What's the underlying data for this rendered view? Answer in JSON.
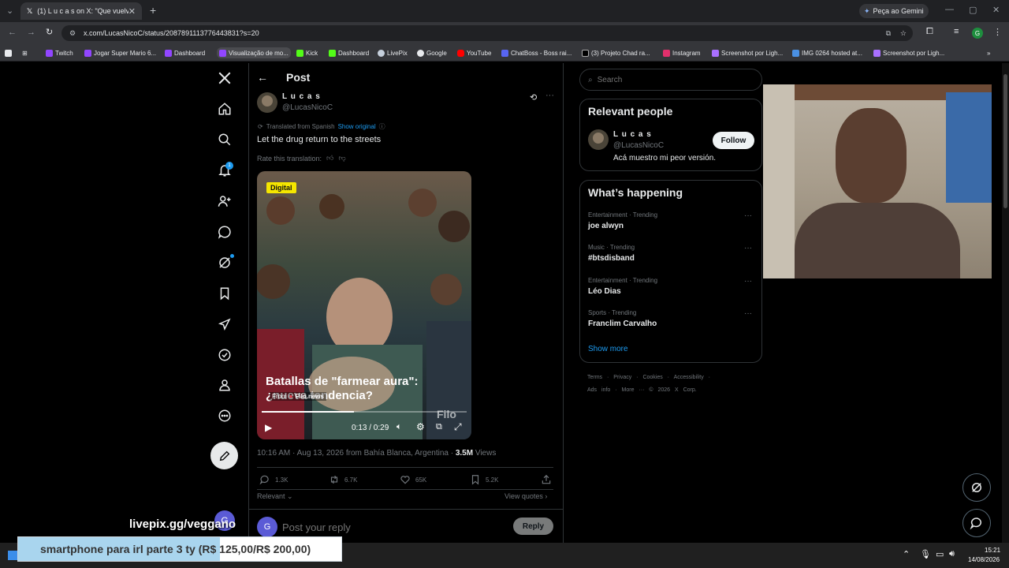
{
  "browser": {
    "active_tab_title": "(1) L u c a s on X: \"Que vuelva l...",
    "gemini_button": "Peça ao Gemini",
    "url": "x.com/LucasNicoC/status/2087891113776443831?s=20",
    "profile_initial": "G",
    "bookmarks": [
      "Twitch",
      "Jogar Super Mario 6...",
      "Dashboard",
      "Visualização de mo...",
      "Kick",
      "Dashboard",
      "LivePix",
      "Google",
      "YouTube",
      "ChatBoss - Boss rai...",
      "(3) Projeto Chad ra...",
      "Instagram",
      "Screenshot por Ligh...",
      "IMG 0264 hosted at...",
      "Screenshot por Ligh..."
    ]
  },
  "nav": {
    "notification_count": "1",
    "account_initial": "G"
  },
  "post": {
    "header_title": "Post",
    "author_name": "L u c a s",
    "author_handle": "@LucasNicoC",
    "translated_label": "Translated from Spanish",
    "show_original": "Show original",
    "text": "Let the drug return to the streets",
    "rate_translation": "Rate this translation:",
    "video": {
      "badge": "Digital",
      "caption_line1": "Batallas de \"farmear aura\":",
      "caption_line2": "¿nueva tendencia?",
      "from_label": "From",
      "source": "Filo.news",
      "watermark": "Filo",
      "time": "0:13 / 0:29",
      "progress": 0.45
    },
    "timestamp": "10:16 AM · Aug 13, 2026 from Bahía Blanca, Argentina · ",
    "views_count": "3.5M",
    "views_label": " Views",
    "replies": "1.3K",
    "reposts": "6.7K",
    "likes": "65K",
    "bookmarks": "5.2K",
    "relevant_label": "Relevant",
    "view_quotes": "View quotes",
    "reply_placeholder": "Post your reply",
    "reply_button": "Reply"
  },
  "sidebar": {
    "search_placeholder": "Search",
    "relevant_people_title": "Relevant people",
    "person_name": "L u c a s",
    "person_handle": "@LucasNicoC",
    "person_bio": "Acá muestro mi peor versión.",
    "follow_label": "Follow",
    "whats_happening_title": "What’s happening",
    "trends": [
      {
        "category": "Entertainment · Trending",
        "name": "joe alwyn"
      },
      {
        "category": "Music · Trending",
        "name": "#btsdisband"
      },
      {
        "category": "Entertainment · Trending",
        "name": "Léo Dias"
      },
      {
        "category": "Sports · Trending",
        "name": "Franclim Carvalho"
      }
    ],
    "show_more": "Show more",
    "footer_line1": "Terms · Privacy · Cookies · Accessibility ·",
    "footer_line2": "Ads info · More ··· © 2026 X Corp."
  },
  "overlay": {
    "livepix_text": "livepix.gg/veggano",
    "goal_text": "smartphone para irl parte 3 ty (R$ 125,00/R$ 200,00)",
    "goal_progress": 0.625
  },
  "taskbar": {
    "time": "15:21",
    "date": "14/08/2026"
  },
  "colors": {
    "background": "#000000",
    "accent": "#1d9bf0",
    "text": "#e7e9ea",
    "muted": "#71767b",
    "badge": "#f5e600"
  }
}
